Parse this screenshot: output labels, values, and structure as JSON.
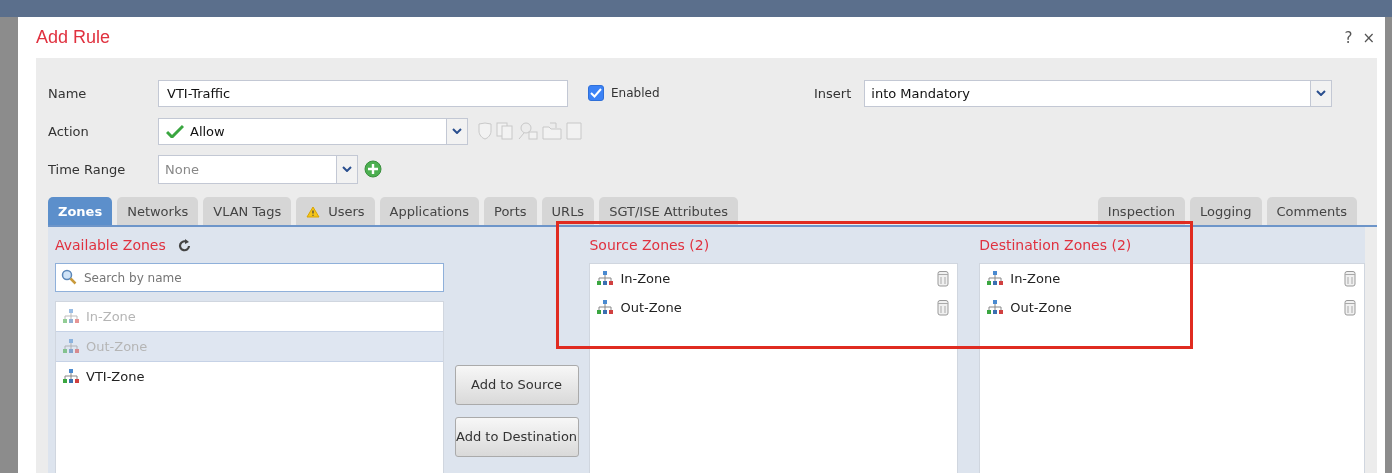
{
  "dialog": {
    "title": "Add Rule",
    "help": "?",
    "close": "×"
  },
  "form": {
    "name_label": "Name",
    "name_value": "VTI-Traffic",
    "enabled_label": "Enabled",
    "enabled": true,
    "insert_label": "Insert",
    "insert_value": "into Mandatory",
    "action_label": "Action",
    "action_value": "Allow",
    "time_range_label": "Time Range",
    "time_range_value": "None"
  },
  "tabs": [
    {
      "label": "Zones",
      "selected": true,
      "warning": false
    },
    {
      "label": "Networks",
      "selected": false,
      "warning": false
    },
    {
      "label": "VLAN Tags",
      "selected": false,
      "warning": false
    },
    {
      "label": "Users",
      "selected": false,
      "warning": true
    },
    {
      "label": "Applications",
      "selected": false,
      "warning": false
    },
    {
      "label": "Ports",
      "selected": false,
      "warning": false
    },
    {
      "label": "URLs",
      "selected": false,
      "warning": false
    },
    {
      "label": "SGT/ISE Attributes",
      "selected": false,
      "warning": false
    }
  ],
  "right_tabs": [
    {
      "label": "Inspection",
      "selected": false
    },
    {
      "label": "Logging",
      "selected": false
    },
    {
      "label": "Comments",
      "selected": false
    }
  ],
  "available": {
    "title": "Available Zones",
    "search_placeholder": "Search by name",
    "items": [
      {
        "label": "In-Zone",
        "disabled": true,
        "selected": false
      },
      {
        "label": "Out-Zone",
        "disabled": true,
        "selected": true
      },
      {
        "label": "VTI-Zone",
        "disabled": false,
        "selected": false
      }
    ]
  },
  "buttons": [
    "Add to Source",
    "Add to Destination"
  ],
  "source": {
    "title": "Source Zones (2)",
    "items": [
      "In-Zone",
      "Out-Zone"
    ]
  },
  "destination": {
    "title": "Destination Zones (2)",
    "items": [
      "In-Zone",
      "Out-Zone"
    ]
  }
}
